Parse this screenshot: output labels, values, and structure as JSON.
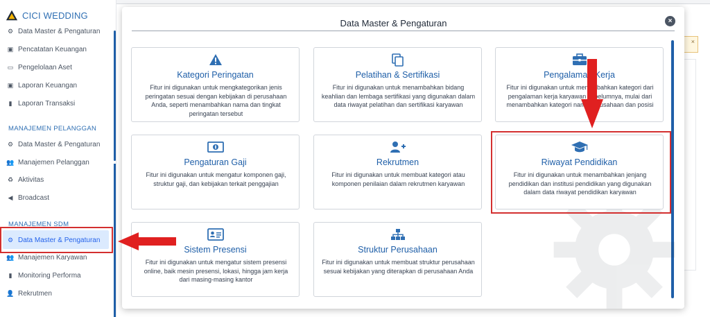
{
  "brand": {
    "name": "CICI WEDDING"
  },
  "sidebar": {
    "items_top": [
      {
        "label": "Data Master & Pengaturan",
        "icon": "gears-icon"
      },
      {
        "label": "Pencatatan Keuangan",
        "icon": "money-icon"
      },
      {
        "label": "Pengelolaan Aset",
        "icon": "asset-icon"
      },
      {
        "label": "Laporan Keuangan",
        "icon": "money-icon"
      },
      {
        "label": "Laporan Transaksi",
        "icon": "book-icon"
      }
    ],
    "section_pelanggan": "MANAJEMEN PELANGGAN",
    "items_pelanggan": [
      {
        "label": "Data Master & Pengaturan",
        "icon": "gears-icon"
      },
      {
        "label": "Manajemen Pelanggan",
        "icon": "users-icon"
      },
      {
        "label": "Aktivitas",
        "icon": "recycle-icon"
      },
      {
        "label": "Broadcast",
        "icon": "bullhorn-icon"
      }
    ],
    "section_sdm": "MANAJEMEN SDM",
    "items_sdm": [
      {
        "label": "Data Master & Pengaturan",
        "icon": "gears-icon",
        "active": true
      },
      {
        "label": "Manajemen Karyawan",
        "icon": "users-icon"
      },
      {
        "label": "Monitoring Performa",
        "icon": "book-icon"
      },
      {
        "label": "Rekrutmen",
        "icon": "user-plus-icon"
      }
    ]
  },
  "background": {
    "alert_close": "×"
  },
  "modal": {
    "title": "Data Master & Pengaturan",
    "close_label": "×",
    "cards": [
      {
        "title": "Kategori Peringatan",
        "icon": "warning-icon",
        "description": "Fitur ini digunakan untuk mengkategorikan jenis peringatan sesuai dengan kebijakan di perusahaan Anda, seperti menambahkan nama dan tingkat peringatan tersebut"
      },
      {
        "title": "Pelatihan & Sertifikasi",
        "icon": "copy-icon",
        "description": "Fitur ini digunakan untuk menambahkan bidang keahlian dan lembaga sertifikasi yang digunakan dalam data riwayat pelatihan dan sertifikasi karyawan"
      },
      {
        "title": "Pengalaman Kerja",
        "icon": "briefcase-icon",
        "description": "Fitur ini digunakan untuk menambahkan kategori dari pengalaman kerja karyawan sebelumnya, mulai dari menambahkan kategori nama perusahaan dan posisi"
      },
      {
        "title": "Pengaturan Gaji",
        "icon": "money-bill-icon",
        "description": "Fitur ini digunakan untuk mengatur komponen gaji, struktur gaji, dan kebijakan terkait penggajian"
      },
      {
        "title": "Rekrutmen",
        "icon": "user-plus-icon",
        "description": "Fitur ini digunakan untuk membuat kategori atau komponen penilaian dalam rekrutmen karyawan"
      },
      {
        "title": "Riwayat Pendidikan",
        "icon": "graduation-cap-icon",
        "description": "Fitur ini digunakan untuk menambahkan jenjang pendidikan dan institusi pendidikan yang digunakan dalam data riwayat pendidikan karyawan"
      },
      {
        "title": "Sistem Presensi",
        "icon": "id-card-icon",
        "description": "Fitur ini digunakan untuk mengatur sistem presensi online, baik mesin presensi, lokasi, hingga jam kerja dari masing-masing kantor"
      },
      {
        "title": "Struktur Perusahaan",
        "icon": "sitemap-icon",
        "description": "Fitur ini digunakan untuk membuat struktur perusahaan sesuai kebijakan yang diterapkan di perusahaan Anda"
      }
    ]
  },
  "colors": {
    "accent": "#1f5fa8",
    "highlight": "#d32f2f",
    "active_bg": "#dbeafe"
  }
}
